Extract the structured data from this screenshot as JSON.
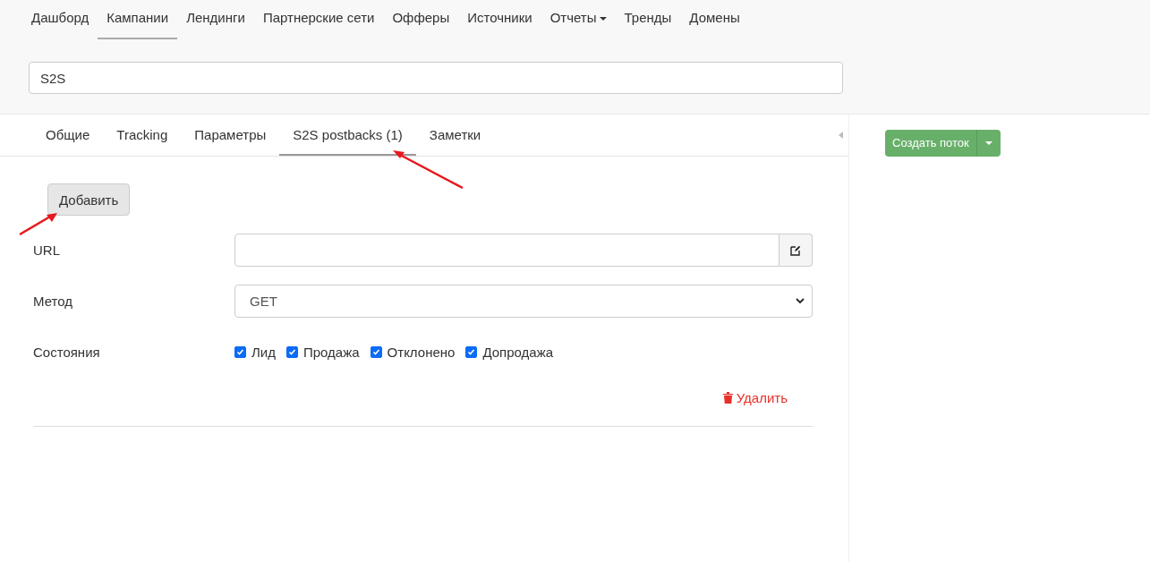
{
  "nav": [
    {
      "label": "Дашборд",
      "selected": false,
      "dropdown": false
    },
    {
      "label": "Кампании",
      "selected": true,
      "dropdown": false
    },
    {
      "label": "Лендинги",
      "selected": false,
      "dropdown": false
    },
    {
      "label": "Партнерские сети",
      "selected": false,
      "dropdown": false
    },
    {
      "label": "Офферы",
      "selected": false,
      "dropdown": false
    },
    {
      "label": "Источники",
      "selected": false,
      "dropdown": false
    },
    {
      "label": "Отчеты",
      "selected": false,
      "dropdown": true
    },
    {
      "label": "Тренды",
      "selected": false,
      "dropdown": false
    },
    {
      "label": "Домены",
      "selected": false,
      "dropdown": false
    }
  ],
  "campaign_name": {
    "value": "S2S"
  },
  "tabs": [
    {
      "label": "Общие",
      "selected": false
    },
    {
      "label": "Tracking",
      "selected": false
    },
    {
      "label": "Параметры",
      "selected": false
    },
    {
      "label": "S2S postbacks (1)",
      "selected": true
    },
    {
      "label": "Заметки",
      "selected": false
    }
  ],
  "add_button": "Добавить",
  "form": {
    "url_label": "URL",
    "method_label": "Метод",
    "method_value": "GET",
    "states_label": "Состояния",
    "states": [
      {
        "label": "Лид",
        "checked": true
      },
      {
        "label": "Продажа",
        "checked": true
      },
      {
        "label": "Отклонено",
        "checked": true
      },
      {
        "label": "Допродажа",
        "checked": true
      }
    ],
    "delete": "Удалить"
  },
  "create_stream_button": "Создать поток"
}
